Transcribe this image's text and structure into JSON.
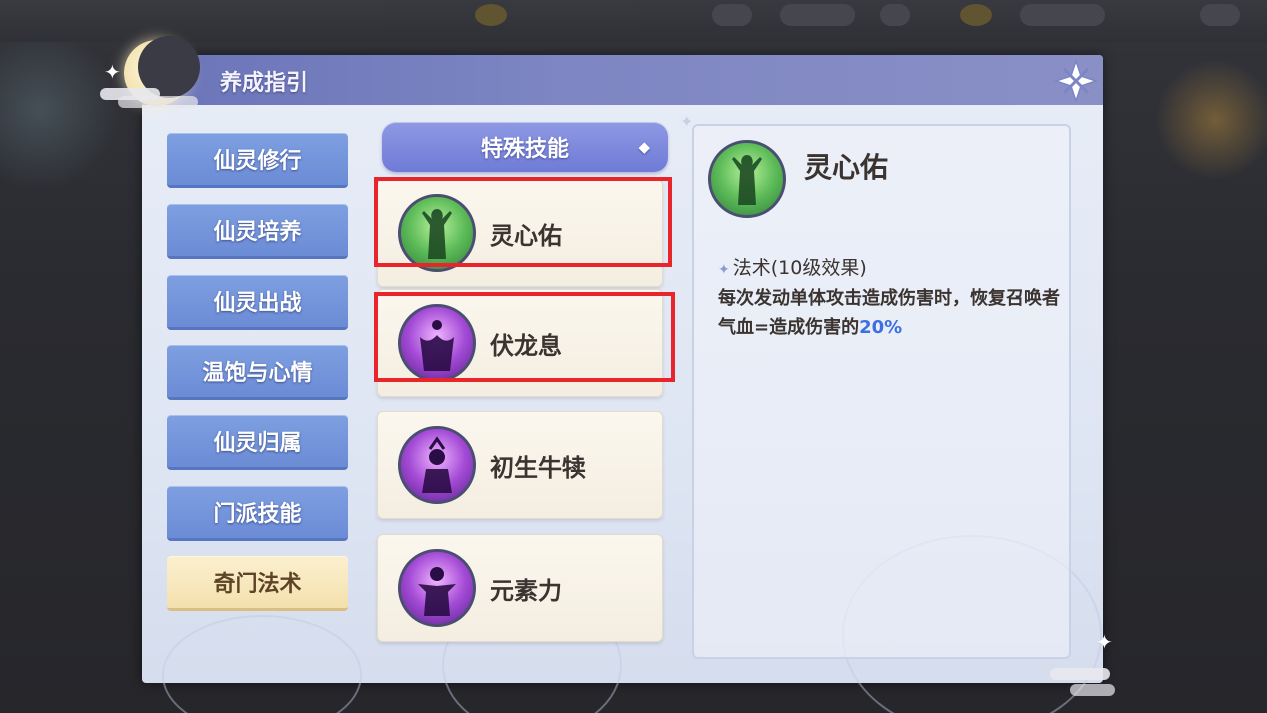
{
  "panel": {
    "title": "养成指引"
  },
  "sidebar": {
    "items": [
      {
        "label": "仙灵修行",
        "active": false
      },
      {
        "label": "仙灵培养",
        "active": false
      },
      {
        "label": "仙灵出战",
        "active": false
      },
      {
        "label": "温饱与心情",
        "active": false
      },
      {
        "label": "仙灵归属",
        "active": false
      },
      {
        "label": "门派技能",
        "active": false
      },
      {
        "label": "奇门法术",
        "active": true
      }
    ]
  },
  "category": {
    "label": "特殊技能",
    "arrow_icon": "chevron-down-icon"
  },
  "skills": [
    {
      "name": "灵心佑",
      "icon": "green-spirit-icon",
      "color": "#5dbb58",
      "highlighted": true
    },
    {
      "name": "伏龙息",
      "icon": "purple-spirit-icon",
      "color": "#a44bd6",
      "highlighted": true
    },
    {
      "name": "初生牛犊",
      "icon": "purple-spirit-icon",
      "color": "#a44bd6",
      "highlighted": false
    },
    {
      "name": "元素力",
      "icon": "purple-spirit-icon",
      "color": "#a44bd6",
      "highlighted": false
    }
  ],
  "detail": {
    "title": "灵心佑",
    "subtitle": "法术(10级效果)",
    "desc_main": "每次发动单体攻击造成伤害时，恢复召唤者气血=造成伤害的",
    "desc_percent": "20%",
    "percent_color": "#3d6fe0"
  },
  "colors": {
    "sidebar_button": "#6b8cd6",
    "sidebar_active": "#f4e0ad",
    "highlight_border": "#e8252a",
    "header": "#7e86c3"
  }
}
